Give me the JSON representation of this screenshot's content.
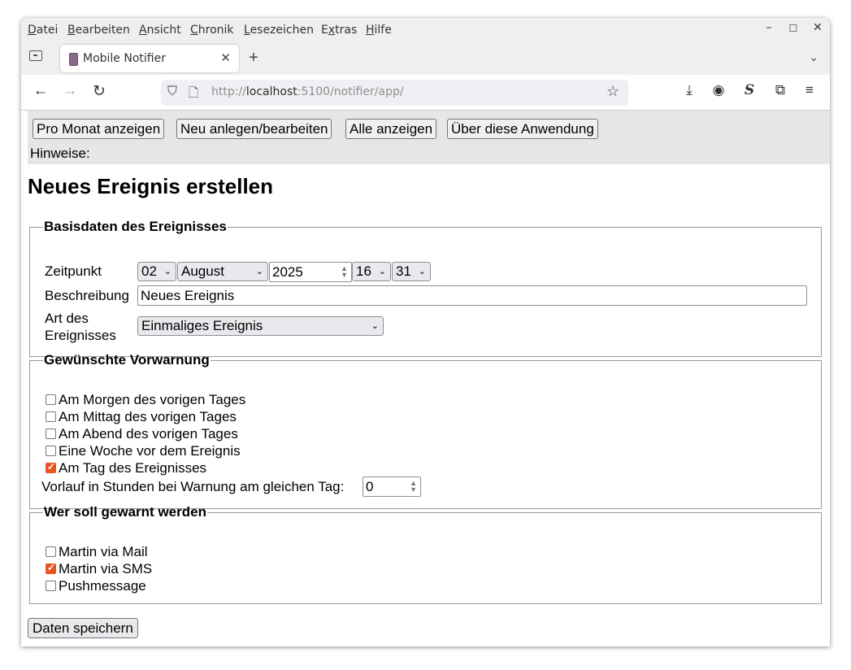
{
  "menubar": {
    "items": [
      {
        "label": "Datei",
        "mnemonic": "D",
        "rest": "atei"
      },
      {
        "label": "Bearbeiten",
        "mnemonic": "B",
        "rest": "earbeiten"
      },
      {
        "label": "Ansicht",
        "mnemonic": "A",
        "rest": "nsicht"
      },
      {
        "label": "Chronik",
        "mnemonic": "C",
        "rest": "hronik"
      },
      {
        "label": "Lesezeichen",
        "mnemonic": "L",
        "rest": "esezeichen"
      },
      {
        "label": "Extras",
        "pre": "E",
        "mnemonic": "x",
        "rest": "tras"
      },
      {
        "label": "Hilfe",
        "mnemonic": "H",
        "rest": "ilfe"
      }
    ],
    "window_controls": {
      "minimize": "–",
      "maximize": "☐",
      "close": "✕"
    }
  },
  "tabbar": {
    "tab_title": "Mobile Notifier",
    "tab_close": "✕",
    "new_tab": "+",
    "list_all": "⌄"
  },
  "navbar": {
    "back": "←",
    "forward": "→",
    "reload": "↻",
    "url_scheme": "http://",
    "url_host": "localhost",
    "url_rest": ":5100/notifier/app/",
    "shield_icon": "⛉",
    "page_icon": "🗋",
    "bookmark_star": "☆",
    "tools": {
      "download": "⤓",
      "account": "◉",
      "extension_s": "S",
      "extensions": "⧉",
      "menu": "≡"
    }
  },
  "page": {
    "nav_buttons": [
      "Pro Monat anzeigen",
      "Neu anlegen/bearbeiten",
      "Alle anzeigen",
      "Über diese Anwendung"
    ],
    "hinweise": "Hinweise:",
    "title": "Neues Ereignis erstellen",
    "basis": {
      "legend": "Basisdaten des Ereignisses",
      "zeitpunkt_label": "Zeitpunkt",
      "day": "02",
      "month": "August",
      "year": "2025",
      "hour": "16",
      "minute": "31",
      "beschreibung_label": "Beschreibung",
      "beschreibung_value": "Neues Ereignis",
      "art_label_line1": "Art des",
      "art_label_line2": "Ereignisses",
      "art_value": "Einmaliges Ereignis"
    },
    "vorwarnung": {
      "legend": "Gewünschte Vorwarnung",
      "options": [
        {
          "label": "Am Morgen des vorigen Tages",
          "checked": false
        },
        {
          "label": "Am Mittag des vorigen Tages",
          "checked": false
        },
        {
          "label": "Am Abend des vorigen Tages",
          "checked": false
        },
        {
          "label": "Eine Woche vor dem Ereignis",
          "checked": false
        },
        {
          "label": "Am Tag des Ereignisses",
          "checked": true
        }
      ],
      "vorlauf_label": "Vorlauf in Stunden bei Warnung am gleichen Tag:",
      "vorlauf_value": "0"
    },
    "empfaenger": {
      "legend": "Wer soll gewarnt werden",
      "options": [
        {
          "label": "Martin via Mail",
          "checked": false
        },
        {
          "label": "Martin via SMS",
          "checked": true
        },
        {
          "label": "Pushmessage",
          "checked": false
        }
      ]
    },
    "save_button": "Daten speichern"
  },
  "colors": {
    "accent": "#e95420",
    "nav_bg": "#e6e6e6",
    "chrome_bg": "#efefef"
  }
}
